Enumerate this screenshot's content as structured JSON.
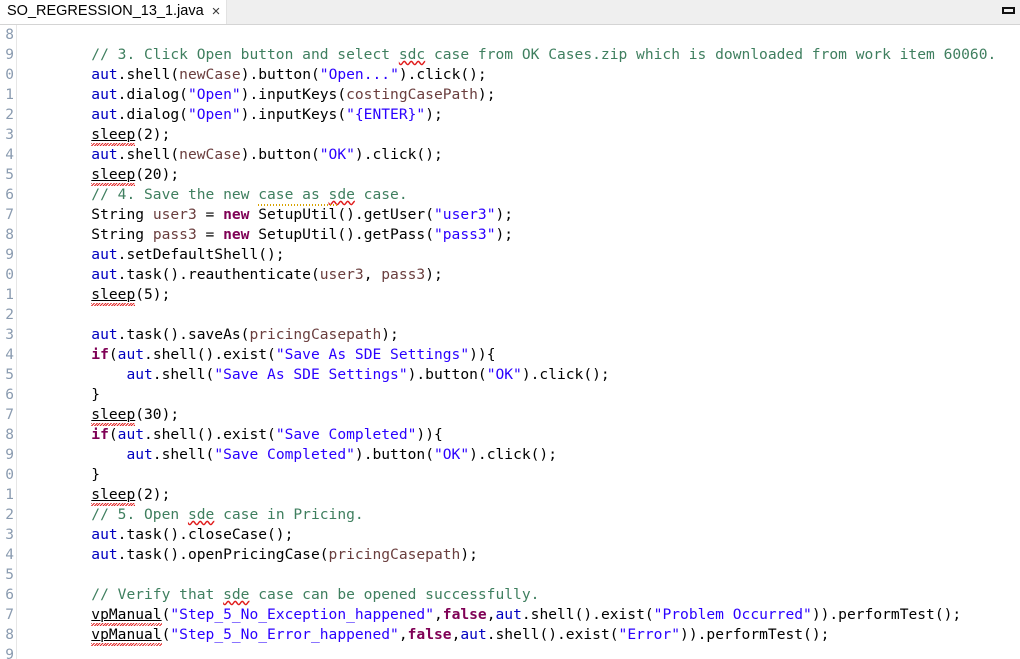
{
  "window": {
    "restore_icon": "restore-window-icon"
  },
  "tab": {
    "label": "SO_REGRESSION_13_1.java",
    "close_glyph": "×"
  },
  "gutter": {
    "comment": "Line numbers are horizontally clipped by the window edge; only trailing digits are visible.",
    "line_numbers": [
      "8",
      "9",
      "0",
      "1",
      "2",
      "3",
      "4",
      "5",
      "6",
      "7",
      "8",
      "9",
      "0",
      "1",
      "2",
      "3",
      "4",
      "5",
      "6",
      "7",
      "8",
      "9",
      "0",
      "1",
      "2",
      "3",
      "4",
      "5",
      "6",
      "7",
      "8",
      "9"
    ]
  },
  "code": {
    "language": "java",
    "lines": [
      {
        "n": "8",
        "tokens": []
      },
      {
        "n": "9",
        "tokens": [
          {
            "c": "plain",
            "t": "        "
          },
          {
            "c": "cmt",
            "t": "// 3. Click Open button and select "
          },
          {
            "c": "cmt sq",
            "t": "sdc"
          },
          {
            "c": "cmt",
            "t": " case from OK Cases.zip which is downloaded from work item 60060."
          }
        ]
      },
      {
        "n": "0",
        "tokens": [
          {
            "c": "plain",
            "t": "        "
          },
          {
            "c": "fld",
            "t": "aut"
          },
          {
            "c": "plain",
            "t": ".shell("
          },
          {
            "c": "par",
            "t": "newCase"
          },
          {
            "c": "plain",
            "t": ")."
          },
          {
            "c": "plain",
            "t": "button("
          },
          {
            "c": "str",
            "t": "\"Open...\""
          },
          {
            "c": "plain",
            "t": ").click();"
          }
        ]
      },
      {
        "n": "1",
        "tokens": [
          {
            "c": "plain",
            "t": "        "
          },
          {
            "c": "fld",
            "t": "aut"
          },
          {
            "c": "plain",
            "t": ".dialog("
          },
          {
            "c": "str",
            "t": "\"Open\""
          },
          {
            "c": "plain",
            "t": ").inputKeys("
          },
          {
            "c": "par",
            "t": "costingCasePath"
          },
          {
            "c": "plain",
            "t": ");"
          }
        ]
      },
      {
        "n": "2",
        "tokens": [
          {
            "c": "plain",
            "t": "        "
          },
          {
            "c": "fld",
            "t": "aut"
          },
          {
            "c": "plain",
            "t": ".dialog("
          },
          {
            "c": "str",
            "t": "\"Open\""
          },
          {
            "c": "plain",
            "t": ").inputKeys("
          },
          {
            "c": "str",
            "t": "\"{ENTER}\""
          },
          {
            "c": "plain",
            "t": ");"
          }
        ]
      },
      {
        "n": "3",
        "tokens": [
          {
            "c": "plain",
            "t": "        "
          },
          {
            "c": "plain stat-sq",
            "t": "sleep"
          },
          {
            "c": "plain",
            "t": "(2);"
          }
        ]
      },
      {
        "n": "4",
        "tokens": [
          {
            "c": "plain",
            "t": "        "
          },
          {
            "c": "fld",
            "t": "aut"
          },
          {
            "c": "plain",
            "t": ".shell("
          },
          {
            "c": "par",
            "t": "newCase"
          },
          {
            "c": "plain",
            "t": ").button("
          },
          {
            "c": "str",
            "t": "\"OK\""
          },
          {
            "c": "plain",
            "t": ").click();"
          }
        ]
      },
      {
        "n": "5",
        "tokens": [
          {
            "c": "plain",
            "t": "        "
          },
          {
            "c": "plain stat-sq",
            "t": "sleep"
          },
          {
            "c": "plain",
            "t": "(20);"
          }
        ]
      },
      {
        "n": "6",
        "tokens": [
          {
            "c": "plain",
            "t": "        "
          },
          {
            "c": "cmt",
            "t": "// 4. Save the new case as "
          },
          {
            "c": "cmt sq",
            "t": "sde"
          },
          {
            "c": "cmt",
            "t": " case."
          }
        ]
      },
      {
        "n": "7",
        "tokens": [
          {
            "c": "plain",
            "t": "        "
          },
          {
            "c": "plain",
            "t": "String "
          },
          {
            "c": "loc",
            "t": "user3"
          },
          {
            "c": "plain",
            "t": " = "
          },
          {
            "c": "kw",
            "t": "new"
          },
          {
            "c": "plain",
            "t": " "
          },
          {
            "c": "plain warn-top",
            "t": "SetupUtil"
          },
          {
            "c": "plain",
            "t": "().getUser("
          },
          {
            "c": "str",
            "t": "\"user3\""
          },
          {
            "c": "plain",
            "t": ");"
          }
        ]
      },
      {
        "n": "8",
        "tokens": [
          {
            "c": "plain",
            "t": "        "
          },
          {
            "c": "plain",
            "t": "String "
          },
          {
            "c": "loc",
            "t": "pass3"
          },
          {
            "c": "plain",
            "t": " = "
          },
          {
            "c": "kw",
            "t": "new"
          },
          {
            "c": "plain",
            "t": " SetupUtil().getPass("
          },
          {
            "c": "str",
            "t": "\"pass3\""
          },
          {
            "c": "plain",
            "t": ");"
          }
        ]
      },
      {
        "n": "9",
        "tokens": [
          {
            "c": "plain",
            "t": "        "
          },
          {
            "c": "fld",
            "t": "aut"
          },
          {
            "c": "plain",
            "t": ".setDefaultShell();"
          }
        ]
      },
      {
        "n": "0",
        "tokens": [
          {
            "c": "plain",
            "t": "        "
          },
          {
            "c": "fld",
            "t": "aut"
          },
          {
            "c": "plain",
            "t": ".task().reauthenticate("
          },
          {
            "c": "loc",
            "t": "user3"
          },
          {
            "c": "plain",
            "t": ", "
          },
          {
            "c": "loc",
            "t": "pass3"
          },
          {
            "c": "plain",
            "t": ");"
          }
        ]
      },
      {
        "n": "1",
        "tokens": [
          {
            "c": "plain",
            "t": "        "
          },
          {
            "c": "plain stat-sq",
            "t": "sleep"
          },
          {
            "c": "plain",
            "t": "(5);"
          }
        ]
      },
      {
        "n": "2",
        "tokens": []
      },
      {
        "n": "3",
        "tokens": [
          {
            "c": "plain",
            "t": "        "
          },
          {
            "c": "fld",
            "t": "aut"
          },
          {
            "c": "plain",
            "t": ".task().saveAs("
          },
          {
            "c": "par",
            "t": "pricingCasepath"
          },
          {
            "c": "plain",
            "t": ");"
          }
        ]
      },
      {
        "n": "4",
        "tokens": [
          {
            "c": "plain",
            "t": "        "
          },
          {
            "c": "kw",
            "t": "if"
          },
          {
            "c": "plain",
            "t": "("
          },
          {
            "c": "fld",
            "t": "aut"
          },
          {
            "c": "plain",
            "t": ".shell().exist("
          },
          {
            "c": "str",
            "t": "\"Save As SDE Settings\""
          },
          {
            "c": "plain",
            "t": ")){"
          }
        ]
      },
      {
        "n": "5",
        "tokens": [
          {
            "c": "plain",
            "t": "            "
          },
          {
            "c": "fld",
            "t": "aut"
          },
          {
            "c": "plain",
            "t": ".shell("
          },
          {
            "c": "str",
            "t": "\"Save As SDE Settings\""
          },
          {
            "c": "plain",
            "t": ").button("
          },
          {
            "c": "str",
            "t": "\"OK\""
          },
          {
            "c": "plain",
            "t": ").click();"
          }
        ]
      },
      {
        "n": "6",
        "tokens": [
          {
            "c": "plain",
            "t": "        }"
          }
        ]
      },
      {
        "n": "7",
        "tokens": [
          {
            "c": "plain",
            "t": "        "
          },
          {
            "c": "plain stat-sq",
            "t": "sleep"
          },
          {
            "c": "plain",
            "t": "(30);"
          }
        ]
      },
      {
        "n": "8",
        "tokens": [
          {
            "c": "plain",
            "t": "        "
          },
          {
            "c": "kw",
            "t": "if"
          },
          {
            "c": "plain",
            "t": "("
          },
          {
            "c": "fld",
            "t": "aut"
          },
          {
            "c": "plain",
            "t": ".shell().exist("
          },
          {
            "c": "str",
            "t": "\"Save Completed\""
          },
          {
            "c": "plain",
            "t": ")){"
          }
        ]
      },
      {
        "n": "9",
        "tokens": [
          {
            "c": "plain",
            "t": "            "
          },
          {
            "c": "fld",
            "t": "aut"
          },
          {
            "c": "plain",
            "t": ".shell("
          },
          {
            "c": "str",
            "t": "\"Save Completed\""
          },
          {
            "c": "plain",
            "t": ").button("
          },
          {
            "c": "str",
            "t": "\"OK\""
          },
          {
            "c": "plain",
            "t": ").click();"
          }
        ]
      },
      {
        "n": "0",
        "tokens": [
          {
            "c": "plain",
            "t": "        }"
          }
        ]
      },
      {
        "n": "1",
        "tokens": [
          {
            "c": "plain",
            "t": "        "
          },
          {
            "c": "plain stat-sq",
            "t": "sleep"
          },
          {
            "c": "plain",
            "t": "(2);"
          }
        ]
      },
      {
        "n": "2",
        "tokens": [
          {
            "c": "plain",
            "t": "        "
          },
          {
            "c": "cmt",
            "t": "// 5. Open "
          },
          {
            "c": "cmt sq",
            "t": "sde"
          },
          {
            "c": "cmt",
            "t": " case in Pricing."
          }
        ]
      },
      {
        "n": "3",
        "tokens": [
          {
            "c": "plain",
            "t": "        "
          },
          {
            "c": "fld",
            "t": "aut"
          },
          {
            "c": "plain",
            "t": ".task().closeCase();"
          }
        ]
      },
      {
        "n": "4",
        "tokens": [
          {
            "c": "plain",
            "t": "        "
          },
          {
            "c": "fld",
            "t": "aut"
          },
          {
            "c": "plain",
            "t": ".task().openPricingCase("
          },
          {
            "c": "par",
            "t": "pricingCasepath"
          },
          {
            "c": "plain",
            "t": ");"
          }
        ]
      },
      {
        "n": "5",
        "tokens": []
      },
      {
        "n": "6",
        "tokens": [
          {
            "c": "plain",
            "t": "        "
          },
          {
            "c": "cmt",
            "t": "// Verify that "
          },
          {
            "c": "cmt sq",
            "t": "sde"
          },
          {
            "c": "cmt",
            "t": " case can be opened successfully."
          }
        ]
      },
      {
        "n": "7",
        "tokens": [
          {
            "c": "plain",
            "t": "        "
          },
          {
            "c": "plain stat-sq",
            "t": "vpManual"
          },
          {
            "c": "plain",
            "t": "("
          },
          {
            "c": "str",
            "t": "\"Step_5_No_Exception_happened\""
          },
          {
            "c": "plain",
            "t": ","
          },
          {
            "c": "kw",
            "t": "false"
          },
          {
            "c": "plain",
            "t": ","
          },
          {
            "c": "fld",
            "t": "aut"
          },
          {
            "c": "plain",
            "t": ".shell().exist("
          },
          {
            "c": "str",
            "t": "\"Problem Occurred\""
          },
          {
            "c": "plain",
            "t": ")).performTest();"
          }
        ]
      },
      {
        "n": "8",
        "tokens": [
          {
            "c": "plain",
            "t": "        "
          },
          {
            "c": "plain stat-sq",
            "t": "vpManual"
          },
          {
            "c": "plain",
            "t": "("
          },
          {
            "c": "str",
            "t": "\"Step_5_No_Error_happened\""
          },
          {
            "c": "plain",
            "t": ","
          },
          {
            "c": "kw",
            "t": "false"
          },
          {
            "c": "plain",
            "t": ","
          },
          {
            "c": "fld",
            "t": "aut"
          },
          {
            "c": "plain",
            "t": ".shell().exist("
          },
          {
            "c": "str",
            "t": "\"Error\""
          },
          {
            "c": "plain",
            "t": ")).performTest();"
          }
        ]
      },
      {
        "n": "9",
        "tokens": []
      }
    ]
  },
  "colors": {
    "comment": "#3f7f5f",
    "keyword": "#7f0055",
    "string": "#2a00ff",
    "field": "#0000c0",
    "parameter": "#6a3e3e",
    "plain": "#000000",
    "line_number": "#8a9bb0",
    "error_squiggle": "#e01b1b",
    "editor_background": "#ffffff",
    "tab_inactive_background": "#efefef"
  }
}
